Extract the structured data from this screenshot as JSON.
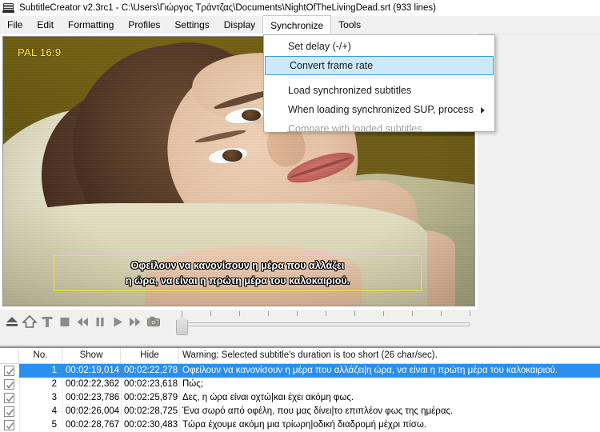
{
  "window": {
    "icon": "monitor-icon",
    "title": "SubtitleCreator v2.3rc1 - C:\\Users\\Γιώργος Τράντζας\\Documents\\NightOfTheLivingDead.srt (933 lines)"
  },
  "menubar": {
    "items": [
      {
        "label": "File",
        "name": "menu-file",
        "active": false
      },
      {
        "label": "Edit",
        "name": "menu-edit",
        "active": false
      },
      {
        "label": "Formatting",
        "name": "menu-formatting",
        "active": false
      },
      {
        "label": "Profiles",
        "name": "menu-profiles",
        "active": false
      },
      {
        "label": "Settings",
        "name": "menu-settings",
        "active": false
      },
      {
        "label": "Display",
        "name": "menu-display",
        "active": false
      },
      {
        "label": "Synchronize",
        "name": "menu-synchronize",
        "active": true
      },
      {
        "label": "Tools",
        "name": "menu-tools",
        "active": false
      }
    ]
  },
  "dropdown": {
    "owner": "Synchronize",
    "items": [
      {
        "label": "Set delay (-/+)",
        "state": "normal",
        "submenu": false
      },
      {
        "label": "Convert frame rate",
        "state": "highlighted",
        "submenu": false
      },
      {
        "label": "Load synchronized subtitles",
        "state": "normal",
        "submenu": false
      },
      {
        "label": "When loading synchronized SUP, process",
        "state": "normal",
        "submenu": true
      },
      {
        "label": "Compare with loaded subtitles",
        "state": "disabled",
        "submenu": false
      }
    ]
  },
  "video": {
    "aspect_label": "PAL 16:9",
    "aspect_label_color": "#ffe840",
    "subtitle_box_color": "#f5e32a",
    "subtitle_lines": [
      "Οφείλουν να κανονίσουν η μέρα που αλλάζει",
      "η ώρα, να είναι η πρώτη μέρα του καλοκαιριού."
    ]
  },
  "toolbar": {
    "buttons": [
      {
        "name": "eject-button",
        "icon": "eject-icon"
      },
      {
        "name": "home-button",
        "icon": "home-icon"
      },
      {
        "name": "text-button",
        "icon": "text-t-icon"
      },
      {
        "name": "stop-button",
        "icon": "stop-icon"
      },
      {
        "name": "previous-button",
        "icon": "skip-back-icon"
      },
      {
        "name": "pause-button",
        "icon": "pause-icon"
      },
      {
        "name": "play-button",
        "icon": "play-icon"
      },
      {
        "name": "next-button",
        "icon": "skip-forward-icon"
      },
      {
        "name": "snapshot-button",
        "icon": "camera-icon"
      }
    ],
    "slider": {
      "value": 0,
      "ticks": 11
    }
  },
  "grid": {
    "columns": [
      "",
      "No.",
      "Show",
      "Hide",
      "Warning: Selected subtitle's duration is too short (26 char/sec)."
    ],
    "rows": [
      {
        "checked": true,
        "no": "1",
        "show": "00:02:19,014",
        "hide": "00:02:22,278",
        "text": "Οφείλουν να κανονίσουν η μέρα που αλλάζει|η ώρα, να είναι η πρώτη μέρα του καλοκαιριού.",
        "selected": true
      },
      {
        "checked": true,
        "no": "2",
        "show": "00:02:22,362",
        "hide": "00:02:23,618",
        "text": "Πώς;",
        "selected": false
      },
      {
        "checked": true,
        "no": "3",
        "show": "00:02:23,786",
        "hide": "00:02:25,879",
        "text": "Δες, η ώρα είναι οχτώ|και έχει ακόμη φως.",
        "selected": false
      },
      {
        "checked": true,
        "no": "4",
        "show": "00:02:26,004",
        "hide": "00:02:28,725",
        "text": "Ένα σωρό από οφέλη, που μας δίνει|το επιπλέον φως της ημέρας.",
        "selected": false
      },
      {
        "checked": true,
        "no": "5",
        "show": "00:02:28,767",
        "hide": "00:02:30,483",
        "text": "Τώρα έχουμε ακόμη μια τρίωρη|οδική διαδρομή μέχρι πίσω.",
        "selected": false
      }
    ]
  },
  "colors": {
    "selection": "#2a8fef",
    "menu_highlight_fill": "#cde8f9",
    "menu_highlight_border": "#3c9ad6",
    "window_bg": "#f0f0f0"
  }
}
